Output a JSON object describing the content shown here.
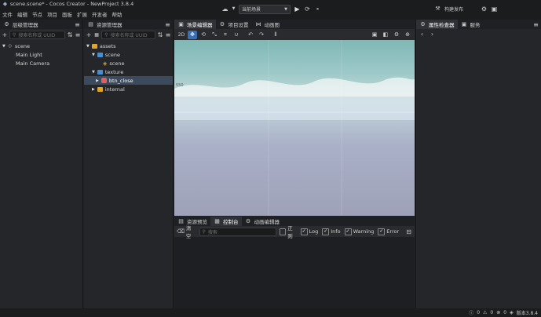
{
  "window": {
    "title": "scene.scene* - Cocos Creator - NewProject 3.8.4"
  },
  "menu": [
    "文件",
    "编辑",
    "节点",
    "项目",
    "面板",
    "扩展",
    "开发者",
    "帮助"
  ],
  "toolbar": {
    "scene_select": "当前场景",
    "publish_label": "构建发布"
  },
  "hierarchy": {
    "tab_label": "层级管理器",
    "search_placeholder": "搜索名称或 UUID",
    "items": [
      {
        "label": "scene"
      },
      {
        "label": "Main Light"
      },
      {
        "label": "Main Camera"
      }
    ]
  },
  "assets": {
    "tab_label": "资源管理器",
    "search_placeholder": "搜索名称或 UUID",
    "items": [
      {
        "label": "assets"
      },
      {
        "label": "scene"
      },
      {
        "label": "scene"
      },
      {
        "label": "texture"
      },
      {
        "label": "btn_close"
      },
      {
        "label": "internal"
      }
    ]
  },
  "scene_editor": {
    "tabs": [
      {
        "label": "场景编辑器"
      },
      {
        "label": "项目设置"
      },
      {
        "label": "动画图"
      }
    ],
    "mode_2d": "2D",
    "ruler_label": "550"
  },
  "inspector": {
    "tab_label": "属性检查器",
    "tab2_label": "服务"
  },
  "console": {
    "tabs": [
      {
        "label": "资源预览"
      },
      {
        "label": "控制台"
      },
      {
        "label": "动画编辑器"
      }
    ],
    "clear_label": "清空",
    "search_placeholder": "搜索",
    "filters": [
      {
        "label": "正则",
        "checked": false
      },
      {
        "label": "Log",
        "checked": true
      },
      {
        "label": "Info",
        "checked": true
      },
      {
        "label": "Warning",
        "checked": true
      },
      {
        "label": "Error",
        "checked": true
      }
    ]
  },
  "status": {
    "count1": "0",
    "count2": "0",
    "count3": "0",
    "version": "版本3.8.4"
  },
  "colors": {
    "accent": "#3a6fb4",
    "folder": "#e0a526",
    "scene_icon": "#e0a526",
    "texture_icon": "#e06060"
  }
}
